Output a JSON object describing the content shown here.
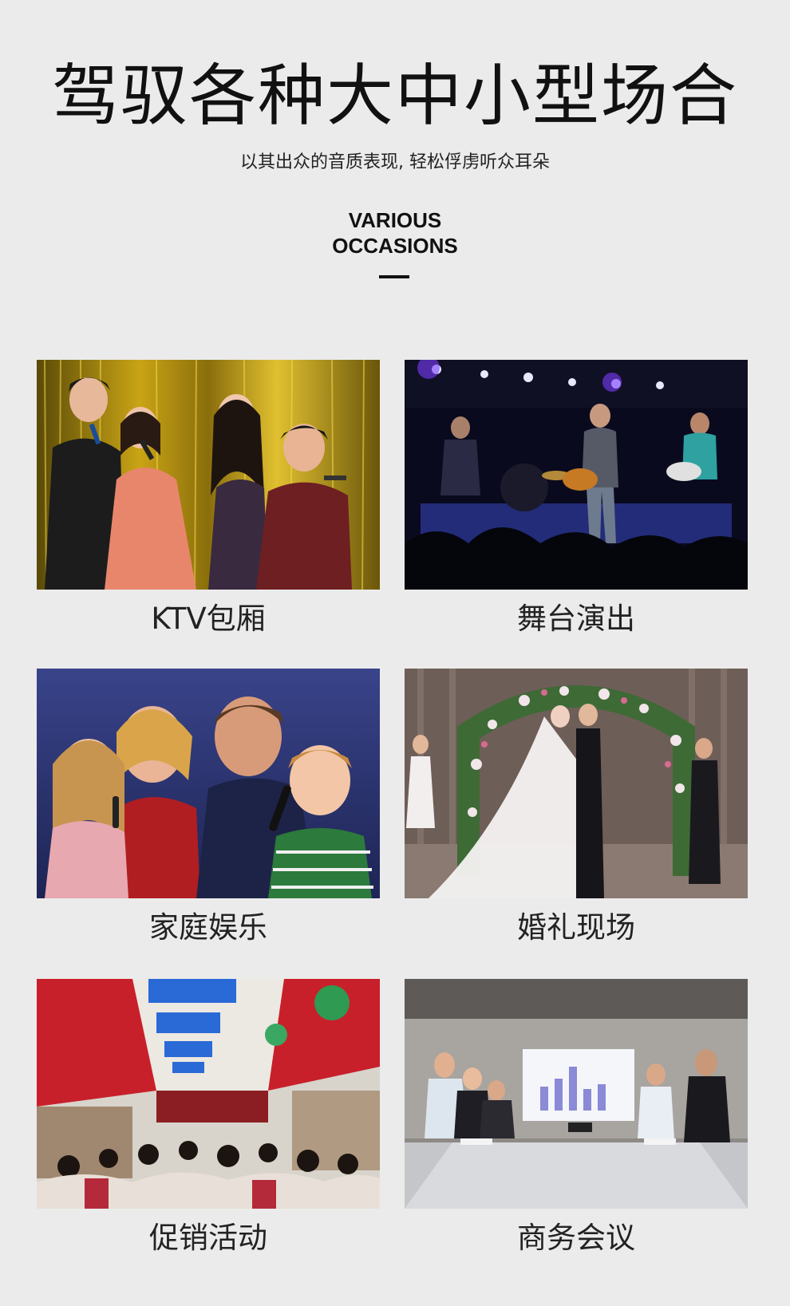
{
  "header": {
    "title": "驾驭各种大中小型场合",
    "subtitle": "以其出众的音质表现, 轻松俘虏听众耳朵",
    "en_title_line1": "VARIOUS",
    "en_title_line2": "OCCASIONS"
  },
  "occasions": [
    {
      "label": "KTV包厢",
      "image": "karaoke-party-photo"
    },
    {
      "label": "舞台演出",
      "image": "stage-band-photo"
    },
    {
      "label": "家庭娱乐",
      "image": "family-singing-photo"
    },
    {
      "label": "婚礼现场",
      "image": "wedding-photo"
    },
    {
      "label": "促销活动",
      "image": "promotion-store-photo"
    },
    {
      "label": "商务会议",
      "image": "business-meeting-photo"
    }
  ],
  "colors": {
    "background": "#ebebeb",
    "text": "#111111"
  }
}
